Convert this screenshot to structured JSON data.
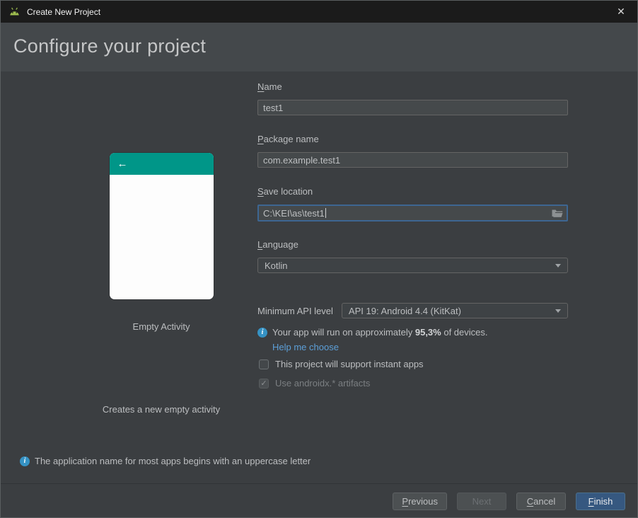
{
  "window": {
    "title": "Create New Project",
    "close_glyph": "✕"
  },
  "header": {
    "title": "Configure your project"
  },
  "template_preview": {
    "name": "Empty Activity",
    "description": "Creates a new empty activity",
    "back_arrow": "←",
    "accent_color": "#009688"
  },
  "form": {
    "name_label": "Name",
    "name_value": "test1",
    "package_label": "Package name",
    "package_value": "com.example.test1",
    "save_label": "Save location",
    "save_value": "C:\\KEI\\as\\test1",
    "language_label": "Language",
    "language_value": "Kotlin",
    "api_label": "Minimum API level",
    "api_value": "API 19: Android 4.4 (KitKat)",
    "api_info_prefix": "Your app will run on approximately ",
    "api_info_bold": "95,3%",
    "api_info_suffix": " of devices.",
    "help_link": "Help me choose",
    "instant_apps_label": "This project will support instant apps",
    "instant_apps_checked": false,
    "androidx_label": "Use androidx.* artifacts",
    "androidx_checked": true
  },
  "footer": {
    "info_text": "The application name for most apps begins with an uppercase letter",
    "previous_label": "Previous",
    "next_label": "Next",
    "cancel_label": "Cancel",
    "finish_label": "Finish"
  },
  "colors": {
    "titlebar": "#1b1b1b",
    "header_band": "#44484b",
    "content_bg": "#3b3e41",
    "focus_border": "#3d6692",
    "primary_button": "#365880",
    "link": "#5c9fd8",
    "info_icon": "#3592c4",
    "template_accent": "#009688",
    "android_green": "#9ebd4f"
  }
}
